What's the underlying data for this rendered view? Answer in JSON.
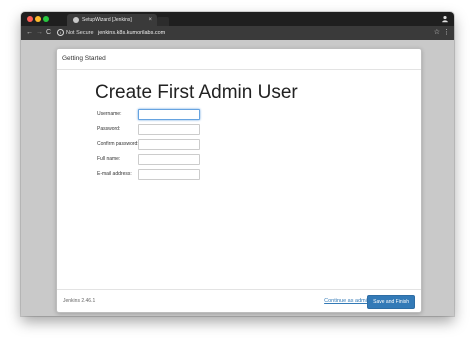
{
  "browser": {
    "tab_title": "SetupWizard [Jenkins]",
    "tab_close": "×",
    "security_label": "Not Secure",
    "url": "jenkins.k8s.kumorilabs.com",
    "nav_back": "←",
    "nav_forward": "→",
    "nav_reload": "C",
    "star": "☆",
    "menu": "⋮",
    "info_glyph": "i"
  },
  "dialog": {
    "header": "Getting Started",
    "title": "Create First Admin User",
    "fields": [
      {
        "label": "Username:",
        "value": "",
        "placeholder": ""
      },
      {
        "label": "Password:",
        "value": "",
        "placeholder": ""
      },
      {
        "label": "Confirm password:",
        "value": "",
        "placeholder": ""
      },
      {
        "label": "Full name:",
        "value": "",
        "placeholder": ""
      },
      {
        "label": "E-mail address:",
        "value": "",
        "placeholder": ""
      }
    ],
    "version": "Jenkins 2.46.1",
    "continue_label": "Continue as admin",
    "save_label": "Save and Finish"
  },
  "colors": {
    "primary_button": "#337ab7",
    "link": "#337ab7",
    "focus_ring": "#66a3e0"
  }
}
